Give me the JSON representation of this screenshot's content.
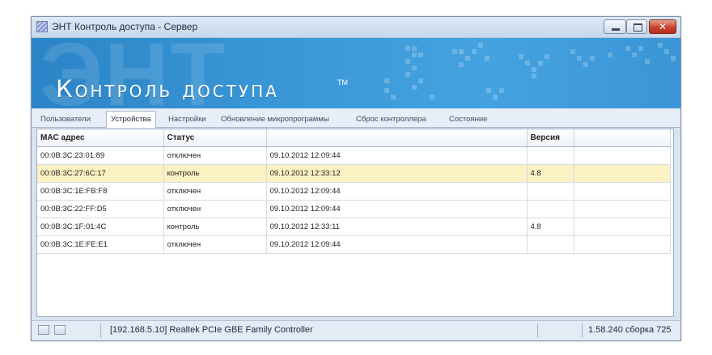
{
  "window": {
    "title": "ЭНТ Контроль доступа - Сервер",
    "controls": {
      "minimize": "",
      "maximize": "",
      "close": "✕"
    }
  },
  "banner": {
    "ghost_text": "ЭНТ",
    "title": "Контроль доступа",
    "trademark": "TM"
  },
  "tabs": [
    {
      "label": "Пользователи",
      "active": false
    },
    {
      "label": "Устройства",
      "active": true
    },
    {
      "label": "Настройки",
      "active": false
    },
    {
      "label": "Обновление микропрограммы",
      "active": false
    },
    {
      "label": "Сброс контроллера",
      "active": false
    },
    {
      "label": "Состояние",
      "active": false
    }
  ],
  "table": {
    "columns": [
      "MAC адрес",
      "Статус",
      "",
      "Версия",
      ""
    ],
    "rows": [
      {
        "mac": "00:0B:3C:23:01:89",
        "status": "отключен",
        "time": "09.10.2012 12:09:44",
        "version": "",
        "extra": "",
        "highlighted": false
      },
      {
        "mac": "00:0B:3C:27:6C:17",
        "status": "контроль",
        "time": "09.10.2012 12:33:12",
        "version": "4.8",
        "extra": "",
        "highlighted": true
      },
      {
        "mac": "00:0B:3C:1E:FB:F8",
        "status": "отключен",
        "time": "09.10.2012 12:09:44",
        "version": "",
        "extra": "",
        "highlighted": false
      },
      {
        "mac": "00:0B:3C:22:FF:D5",
        "status": "отключен",
        "time": "09.10.2012 12:09:44",
        "version": "",
        "extra": "",
        "highlighted": false
      },
      {
        "mac": "00:0B:3C:1F:01:4C",
        "status": "контроль",
        "time": "09.10.2012 12:33:11",
        "version": "4.8",
        "extra": "",
        "highlighted": false
      },
      {
        "mac": "00:0B:3C:1E:FE:E1",
        "status": "отключен",
        "time": "09.10.2012 12:09:44",
        "version": "",
        "extra": "",
        "highlighted": false
      }
    ]
  },
  "statusbar": {
    "network": "[192.168.5.10] Realtek PCIe GBE Family Controller",
    "build": "1.58.240 сборка 725"
  },
  "colors": {
    "banner_blue": "#3a98d8",
    "highlight_row": "#fbf1c2",
    "close_button": "#c9422d"
  }
}
